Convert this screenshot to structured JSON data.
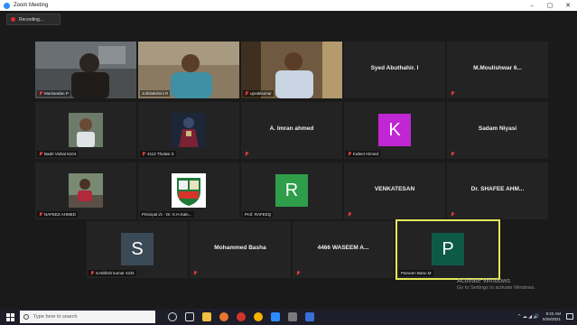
{
  "window": {
    "title": "Zoom Meeting",
    "controls": [
      "–",
      "▢",
      "✕"
    ]
  },
  "recording": {
    "label": "Recording..."
  },
  "participants": [
    {
      "name": "Markandan P",
      "display": "",
      "muted": true,
      "kind": "video"
    },
    {
      "name": "Jothilakshmi R",
      "display": "",
      "muted": false,
      "kind": "video"
    },
    {
      "name": "uprakkumar",
      "display": "",
      "muted": true,
      "kind": "video"
    },
    {
      "name": "",
      "display": "Syed Abuthahir. I",
      "muted": false,
      "kind": "name"
    },
    {
      "name": "",
      "display": "M.Moulishwar 6...",
      "muted": true,
      "kind": "name"
    },
    {
      "name": "Badri Vishal 6104",
      "display": "",
      "muted": true,
      "kind": "picture"
    },
    {
      "name": "4113 Thulasi S",
      "display": "",
      "muted": true,
      "kind": "picture"
    },
    {
      "name": "",
      "display": "A. Imran ahmed",
      "muted": true,
      "kind": "name"
    },
    {
      "name": "Kafeel Ahmed",
      "display": "",
      "muted": true,
      "kind": "avatar",
      "letter": "K",
      "color": "#c026d3"
    },
    {
      "name": "",
      "display": "Sadam Niyasi",
      "muted": true,
      "kind": "name"
    },
    {
      "name": "NAFEEZ AHMED",
      "display": "",
      "muted": true,
      "kind": "picture"
    },
    {
      "name": "Principal i/c - Dr. K.H.Kale...",
      "display": "",
      "muted": false,
      "kind": "logo"
    },
    {
      "name": "Prof. RAFEEQ",
      "display": "",
      "muted": false,
      "kind": "avatar",
      "letter": "R",
      "color": "#2e9e4a"
    },
    {
      "name": "",
      "display": "VENKATESAN",
      "muted": true,
      "kind": "name"
    },
    {
      "name": "",
      "display": "Dr. SHAFEE AHM...",
      "muted": true,
      "kind": "name"
    },
    {
      "name": "S.Nithish kumar 4231",
      "display": "",
      "muted": true,
      "kind": "avatar",
      "letter": "S",
      "color": "#3b4a57"
    },
    {
      "name": "",
      "display": "Mohammed Basha",
      "muted": true,
      "kind": "name"
    },
    {
      "name": "",
      "display": "4466 WASEEM A...",
      "muted": true,
      "kind": "name"
    },
    {
      "name": "Parveen Banu M",
      "display": "",
      "muted": false,
      "kind": "avatar",
      "letter": "P",
      "color": "#0e5a49",
      "active": true
    }
  ],
  "watermark": {
    "title": "Activate Windows",
    "subtitle": "Go to Settings to activate Windows."
  },
  "taskbar": {
    "search_placeholder": "Type here to search",
    "time": "9:22 AM",
    "date": "5/26/2021",
    "tray": "^ ☁ ◢ 🔊"
  },
  "colors": {
    "active_border": "#e4e85a",
    "muted_mic": "#e23a3a",
    "tile_bg": "#232323"
  }
}
